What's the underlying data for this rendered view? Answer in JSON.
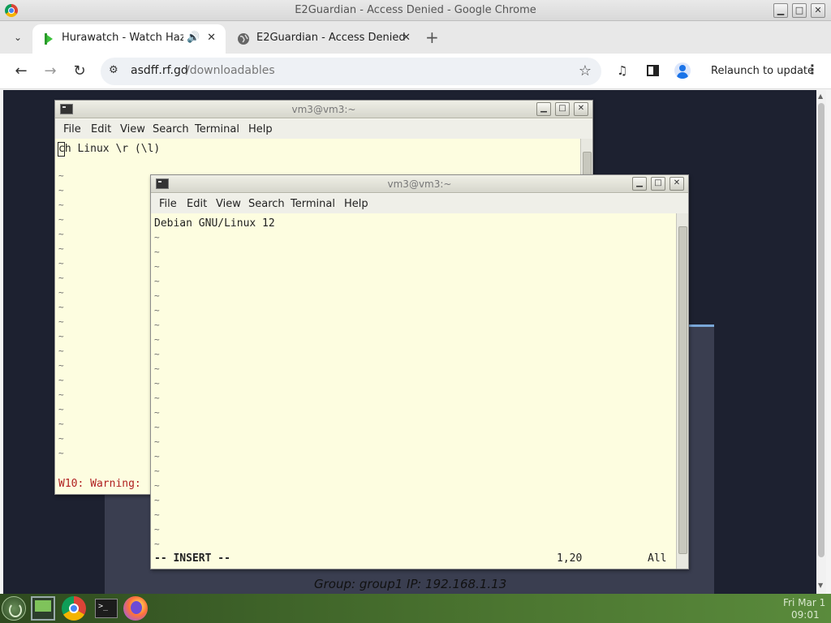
{
  "window": {
    "title": "E2Guardian - Access Denied - Google Chrome",
    "minimize": "▁",
    "maximize": "□",
    "close": "✕"
  },
  "tabs": [
    {
      "title": "Hurawatch - Watch Hazbin",
      "audio": "🔊",
      "close": "✕"
    },
    {
      "title": "E2Guardian - Access Denied",
      "close": "✕"
    }
  ],
  "toolbar": {
    "back": "←",
    "forward": "→",
    "reload": "↻",
    "site_info": "⚙",
    "url_host": "asdff.rf.gd",
    "url_path": "/downloadables",
    "bookmark": "☆",
    "media": "♫",
    "relaunch": "Relaunch to update",
    "menu": "⋮",
    "new_tab": "+",
    "tab_dropdown": "⌄"
  },
  "page": {
    "group_ip": "Group: group1   IP: 192.168.1.13"
  },
  "terminal_back": {
    "title": "vm3@vm3:~",
    "menu": [
      "File",
      "Edit",
      "View",
      "Search",
      "Terminal",
      "Help"
    ],
    "first_line": "ch Linux \\r (\\l)",
    "warning": "W10: Warning:",
    "tilde": "~"
  },
  "terminal_front": {
    "title": "vm3@vm3:~",
    "menu": [
      "File",
      "Edit",
      "View",
      "Search",
      "Terminal",
      "Help"
    ],
    "first_line": "Debian GNU/Linux 12",
    "mode": "-- INSERT --",
    "position": "1,20",
    "scroll": "All",
    "tilde": "~"
  },
  "taskbar": {
    "date": "Fri Mar 1",
    "time": "09:01"
  },
  "colors": {
    "page_bg": "#1d2130",
    "terminal_bg": "#fdfde0",
    "warning_red": "#b02020",
    "taskbar_green": "#4b7530"
  }
}
